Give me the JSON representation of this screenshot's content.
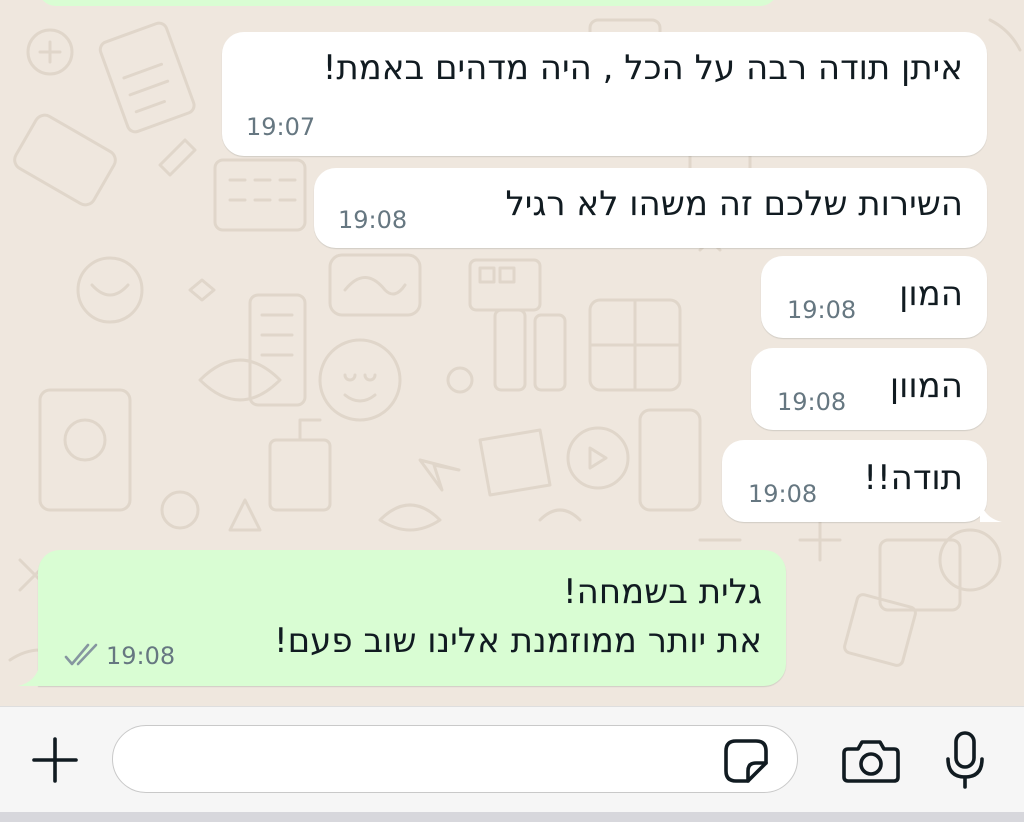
{
  "chat": {
    "messages": [
      {
        "direction": "incoming",
        "text": "איתן תודה רבה על הכל , היה מדהים באמת!",
        "time": "19:07"
      },
      {
        "direction": "incoming",
        "text": "השירות שלכם זה משהו לא רגיל",
        "time": "19:08"
      },
      {
        "direction": "incoming",
        "text": "המון",
        "time": "19:08"
      },
      {
        "direction": "incoming",
        "text": "המוון",
        "time": "19:08"
      },
      {
        "direction": "incoming",
        "text": "תודה!!",
        "time": "19:08"
      },
      {
        "direction": "outgoing",
        "lines": [
          "גלית בשמחה!",
          "את יותר ממוזמנת אלינו שוב פעם!"
        ],
        "time": "19:08",
        "status": "read"
      }
    ]
  },
  "composer": {
    "value": "",
    "placeholder": "",
    "icons": {
      "attach": "plus-icon",
      "sticker": "sticker-icon",
      "camera": "camera-icon",
      "voice": "microphone-icon"
    }
  },
  "colors": {
    "background": "#efe7de",
    "incoming_bubble": "#ffffff",
    "outgoing_bubble": "#d9fdd3",
    "timestamp": "#667781",
    "read_ticks": "#8696a0"
  }
}
